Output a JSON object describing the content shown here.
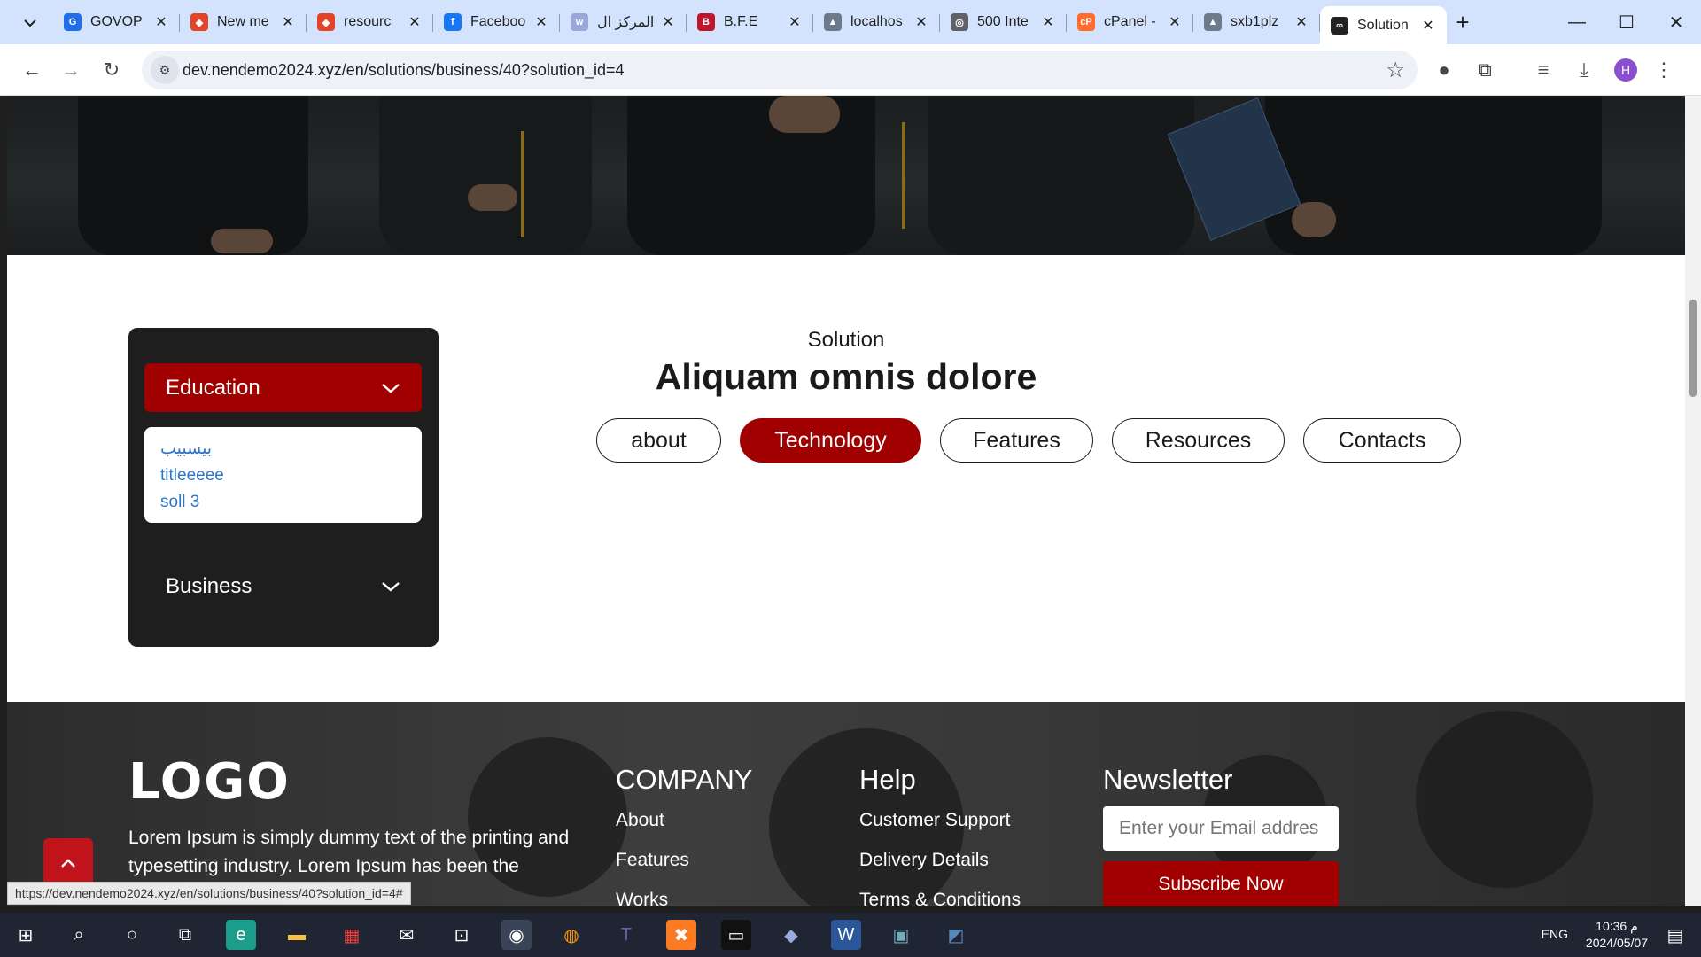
{
  "browser": {
    "tabs": [
      {
        "title": "GOVOP",
        "fav_color": "#1f6feb",
        "fav_glyph": "G"
      },
      {
        "title": "New me",
        "fav_color": "#e24329",
        "fav_glyph": "◆"
      },
      {
        "title": "resourc",
        "fav_color": "#e24329",
        "fav_glyph": "◆"
      },
      {
        "title": "Faceboo",
        "fav_color": "#1877f2",
        "fav_glyph": "f"
      },
      {
        "title": "المركز ال",
        "fav_color": "#9aa7d8",
        "fav_glyph": "w"
      },
      {
        "title": "B.F.E",
        "fav_color": "#c0142b",
        "fav_glyph": "B"
      },
      {
        "title": "localhos",
        "fav_color": "#6c7a89",
        "fav_glyph": "▲"
      },
      {
        "title": "500 Inte",
        "fav_color": "#5f6368",
        "fav_glyph": "◎"
      },
      {
        "title": "cPanel -",
        "fav_color": "#ff6c2c",
        "fav_glyph": "cP"
      },
      {
        "title": "sxb1plz",
        "fav_color": "#6c7a89",
        "fav_glyph": "▲"
      },
      {
        "title": "Solution",
        "fav_color": "#222222",
        "fav_glyph": "∞"
      }
    ],
    "active_tab_index": 10,
    "url": "dev.nendemo2024.xyz/en/solutions/business/40?solution_id=4",
    "profile_initial": "H",
    "status_url": "https://dev.nendemo2024.xyz/en/solutions/business/40?solution_id=4#"
  },
  "sidebar": {
    "education": {
      "label": "Education",
      "links": [
        "بيسبيب",
        "titleeeee",
        "soll 3"
      ]
    },
    "business": {
      "label": "Business"
    }
  },
  "main": {
    "kicker": "Solution",
    "title": "Aliquam omnis dolore",
    "tabs": [
      "about",
      "Technology",
      "Features",
      "Resources",
      "Contacts"
    ],
    "active_tab": "Technology"
  },
  "footer": {
    "logo": "LOGO",
    "about": "Lorem Ipsum is simply dummy text of the printing and typesetting industry. Lorem Ipsum has been the",
    "company": {
      "heading": "COMPANY",
      "links": [
        "About",
        "Features",
        "Works"
      ]
    },
    "help": {
      "heading": "Help",
      "links": [
        "Customer Support",
        "Delivery Details",
        "Terms & Conditions"
      ]
    },
    "newsletter": {
      "heading": "Newsletter",
      "placeholder": "Enter your Email addres",
      "button": "Subscribe Now"
    }
  },
  "taskbar": {
    "lang": "ENG",
    "time": "10:36 م",
    "date": "2024/05/07"
  },
  "colors": {
    "accent": "#a00000",
    "link": "#2e74c9",
    "sidebar_bg": "#1e1e1e"
  }
}
